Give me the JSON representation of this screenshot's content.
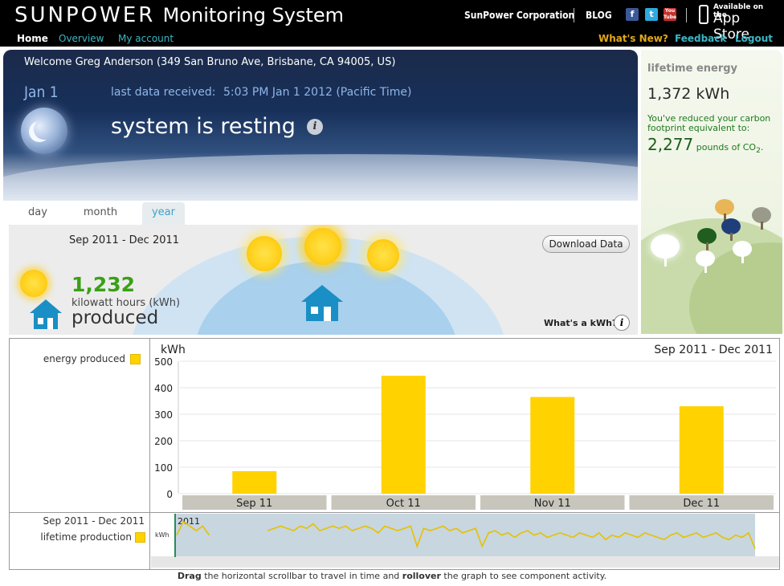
{
  "header": {
    "brand": "SUNPOWER",
    "product": "Monitoring System",
    "corp_link": "SunPower Corporation",
    "blog_link": "BLOG",
    "social": [
      "f",
      "t",
      "You Tube"
    ],
    "appstore_small": "Available on the",
    "appstore_big": "App Store"
  },
  "nav": {
    "home": "Home",
    "overview": "Overview",
    "account": "My account",
    "whats_new": "What's New?",
    "feedback": "Feedback",
    "logout": "Logout"
  },
  "hero": {
    "welcome": "Welcome Greg Anderson (349 San Bruno Ave, Brisbane, CA 94005, US)",
    "date": "Jan 1",
    "last_label": "last data received:",
    "last_value": "5:03 PM Jan 1 2012 (Pacific Time)",
    "status": "system is resting",
    "info": "i"
  },
  "lifetime": {
    "title": "lifetime energy",
    "value": "1,372 kWh",
    "text": "You've reduced your carbon footprint equivalent to:",
    "co2_value": "2,277",
    "co2_unit": "pounds of CO",
    "co2_sub": "2",
    "co2_end": "."
  },
  "tabs": {
    "day": "day",
    "month": "month",
    "year": "year"
  },
  "production": {
    "range": "Sep 2011 - Dec 2011",
    "value": "1,232",
    "unit": "kilowatt hours (kWh)",
    "word": "produced",
    "download": "Download Data",
    "whats_kwh": "What's a kWh?",
    "info": "i"
  },
  "legend": {
    "energy": "energy produced",
    "range": "Sep 2011 - Dec 2011",
    "lifetime": "lifetime production"
  },
  "chart_data": {
    "type": "bar",
    "title": "Sep 2011 - Dec 2011",
    "ylabel": "kWh",
    "xlabel": "",
    "categories": [
      "Sep 11",
      "Oct 11",
      "Nov 11",
      "Dec 11"
    ],
    "values": [
      85,
      445,
      365,
      330
    ],
    "ylim": [
      0,
      500
    ],
    "yticks": [
      0,
      100,
      200,
      300,
      400,
      500
    ],
    "grid": true,
    "bar_color": "#ffd200"
  },
  "mini_chart": {
    "year_label": "2011",
    "ylabel": "kWh",
    "values": [
      8,
      14,
      12,
      10,
      12,
      8,
      14,
      12,
      11,
      10,
      12,
      13,
      11,
      12,
      10,
      11,
      12,
      11,
      10,
      12,
      11,
      13,
      10,
      11,
      12,
      11,
      12,
      10,
      11,
      12,
      11,
      9,
      12,
      11,
      10,
      11,
      12,
      3,
      11,
      10,
      11,
      12,
      10,
      11,
      9,
      10,
      11,
      3,
      9,
      10,
      8,
      9,
      7,
      9,
      10,
      8,
      9,
      7,
      8,
      9,
      8,
      7,
      9,
      8,
      7,
      9,
      6,
      8,
      7,
      9,
      8,
      7,
      9,
      8,
      7,
      6,
      8,
      9,
      7,
      8,
      9,
      7,
      8,
      9,
      7,
      6,
      8,
      7,
      9,
      2
    ]
  },
  "footnote": {
    "pre": "Drag",
    "mid": " the horizontal scrollbar to travel in time and ",
    "rollover": "rollover",
    "post": " the graph to see component activity."
  }
}
